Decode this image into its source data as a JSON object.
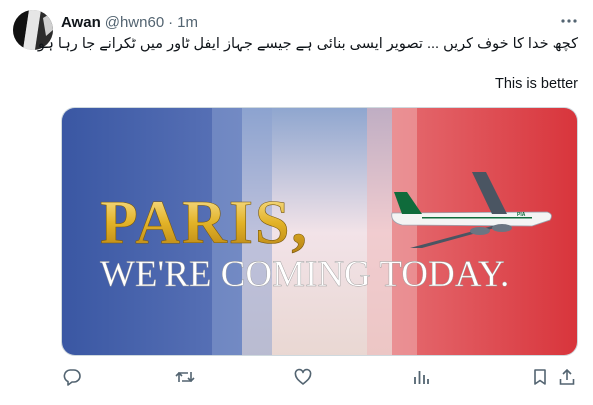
{
  "author": {
    "name": "Awan",
    "handle": "@hwn60",
    "separator": "·",
    "time": "1m"
  },
  "tweet": {
    "urdu_text": "کچھ خدا کا خوف کریں ... تصویر ایسی بنائی ہے جیسے جہاز ایفل ٹاور میں ٹکرانے جا رہا ہو",
    "english_text": "This is better"
  },
  "media": {
    "headline": "PARIS,",
    "subline": "WE'RE COMING TODAY.",
    "flag_colors": [
      "#3f5ea8",
      "#ffffff",
      "#e0474c"
    ],
    "accent_gold": "#e2b227"
  },
  "actions": [
    "reply-icon",
    "repost-icon",
    "like-icon",
    "views-icon",
    "bookmark-icon",
    "share-icon"
  ]
}
